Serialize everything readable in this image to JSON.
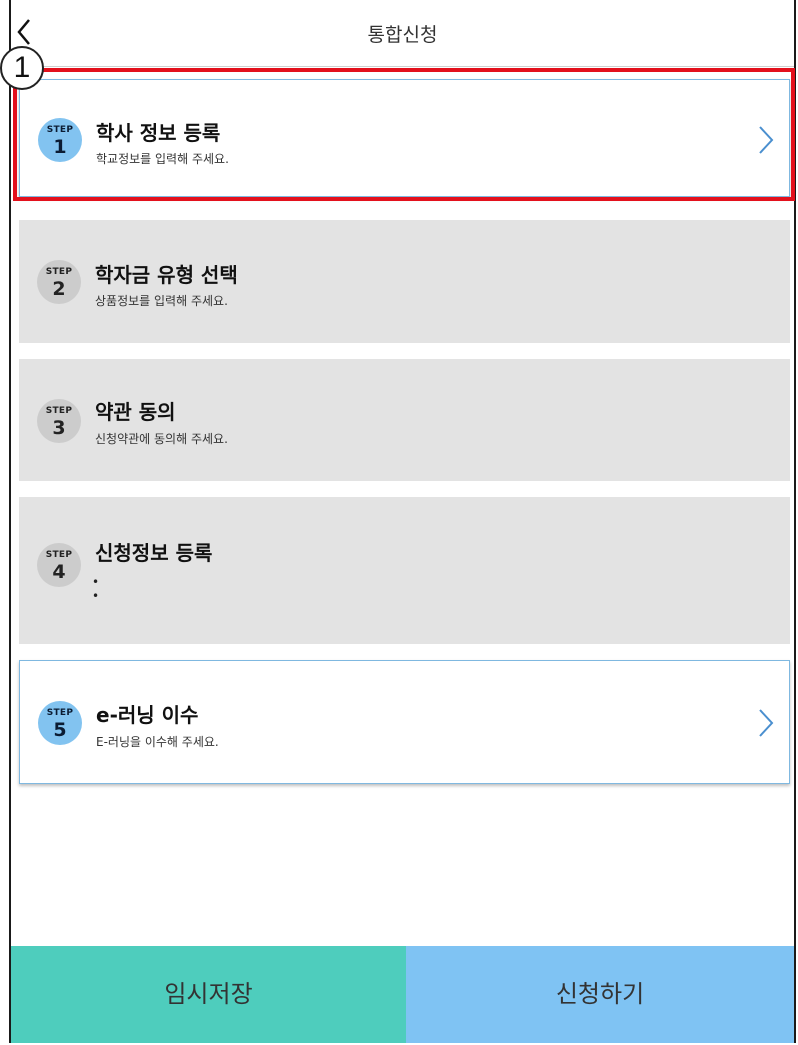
{
  "header": {
    "title": "통합신청",
    "back_icon": "chevron-left-icon"
  },
  "annotation": {
    "number": "1",
    "highlight_color": "#e3101c"
  },
  "steps": [
    {
      "step_word": "STEP",
      "number": "1",
      "title": "학사 정보 등록",
      "subtitle": "학교정보를 입력해 주세요.",
      "state": "active"
    },
    {
      "step_word": "STEP",
      "number": "2",
      "title": "학자금 유형 선택",
      "subtitle": "상품정보를 입력해 주세요.",
      "state": "inactive"
    },
    {
      "step_word": "STEP",
      "number": "3",
      "title": "약관 동의",
      "subtitle": "신청약관에 동의해 주세요.",
      "state": "inactive"
    },
    {
      "step_word": "STEP",
      "number": "4",
      "title": "신청정보 등록",
      "subtitle": "",
      "state": "inactive"
    },
    {
      "step_word": "STEP",
      "number": "5",
      "title": "e-러닝 이수",
      "subtitle": "E-러닝을 이수해 주세요.",
      "state": "active"
    }
  ],
  "buttons": {
    "save_label": "임시저장",
    "apply_label": "신청하기"
  },
  "colors": {
    "save_bg": "#4ecdbd",
    "apply_bg": "#7fc3f3",
    "active_circle": "#82c3f0",
    "inactive_circle": "#cccccc",
    "inactive_card": "#e3e3e3"
  }
}
